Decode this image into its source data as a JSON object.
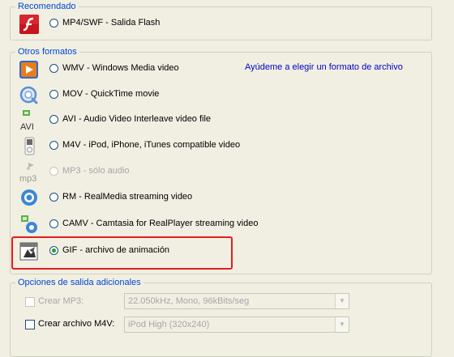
{
  "recommended": {
    "title": "Recomendado",
    "flash": {
      "label": "MP4/SWF - Salida Flash",
      "icon": "flash-icon"
    }
  },
  "other_formats": {
    "title": "Otros formatos",
    "help_link": "Ayúdeme a elegir un formato de archivo",
    "items": [
      {
        "label": "WMV - Windows Media video",
        "icon": "windows-media-icon",
        "enabled": true,
        "checked": false
      },
      {
        "label": "MOV - QuickTime movie",
        "icon": "quicktime-icon",
        "enabled": true,
        "checked": false
      },
      {
        "label": "AVI - Audio Video Interleave video file",
        "icon": "avi-icon",
        "enabled": true,
        "checked": false
      },
      {
        "label": "M4V - iPod, iPhone, iTunes compatible video",
        "icon": "ipod-icon",
        "enabled": true,
        "checked": false
      },
      {
        "label": "MP3 - sólo audio",
        "icon": "mp3-icon",
        "enabled": false,
        "checked": false
      },
      {
        "label": "RM - RealMedia streaming video",
        "icon": "realmedia-icon",
        "enabled": true,
        "checked": false
      },
      {
        "label": "CAMV - Camtasia for RealPlayer streaming video",
        "icon": "camv-icon",
        "enabled": true,
        "checked": false
      },
      {
        "label": "GIF - archivo de animación",
        "icon": "gif-animation-icon",
        "enabled": true,
        "checked": true
      }
    ]
  },
  "additional_options": {
    "title": "Opciones de salida adicionales",
    "mp3": {
      "label": "Crear MP3:",
      "value": "22.050kHz, Mono, 96kBits/seg"
    },
    "m4v": {
      "label": "Crear archivo M4V:",
      "value": "iPod High (320x240)"
    }
  },
  "colors": {
    "accent": "#0046d5",
    "highlight": "#e21d1d",
    "link": "#0000c8"
  }
}
